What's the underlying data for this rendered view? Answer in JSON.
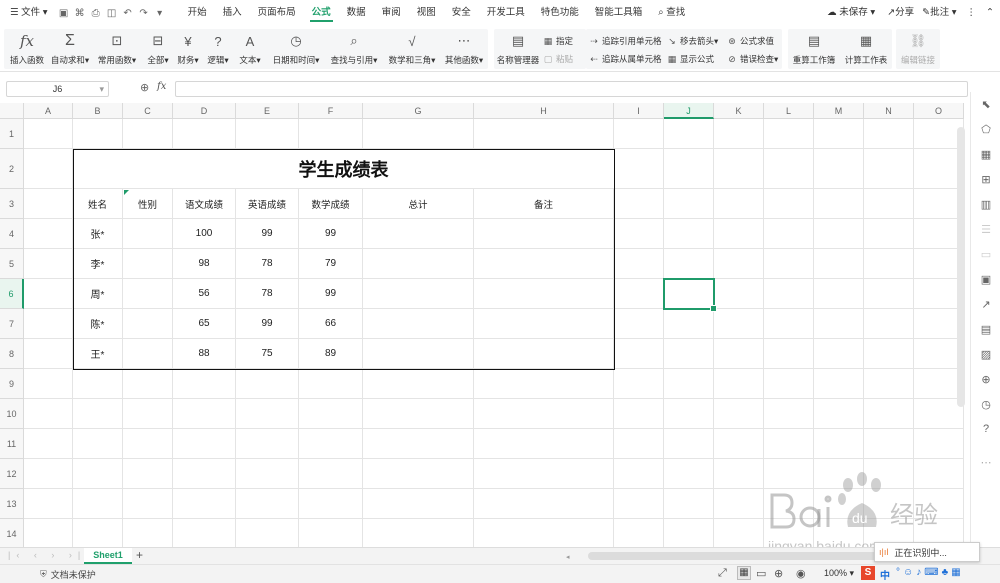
{
  "menu": {
    "file": "文件",
    "tabs": [
      "开始",
      "插入",
      "页面布局",
      "公式",
      "数据",
      "审阅",
      "视图",
      "安全",
      "开发工具",
      "特色功能",
      "智能工具箱"
    ],
    "active_tab": "公式",
    "search": "查找",
    "unsaved": "未保存",
    "share": "分享",
    "comment": "批注"
  },
  "ribbon": {
    "insert_function": "插入函数",
    "autosum": "自动求和",
    "common_functions": "常用函数",
    "all": "全部",
    "finance": "财务",
    "logic": "逻辑",
    "text": "文本",
    "datetime": "日期和时间",
    "lookup": "查找与引用",
    "math": "数学和三角",
    "other": "其他函数",
    "name_manager": "名称管理器",
    "specify": "指定",
    "paste": "粘贴",
    "trace_precedents": "追踪引用单元格",
    "trace_dependents": "追踪从属单元格",
    "remove_arrows": "移去箭头",
    "show_formulas": "显示公式",
    "formula_eval": "公式求值",
    "error_check": "错误检查",
    "recalc_workbook": "重算工作簿",
    "calc_sheet": "计算工作表",
    "edit_links": "编辑链接"
  },
  "formula_bar": {
    "name_box": "J6",
    "fx": "fx",
    "value": ""
  },
  "columns": [
    "A",
    "B",
    "C",
    "D",
    "E",
    "F",
    "G",
    "H",
    "I",
    "J",
    "K",
    "L",
    "M",
    "N",
    "O"
  ],
  "rows": [
    "1",
    "2",
    "3",
    "4",
    "5",
    "6",
    "7",
    "8",
    "9",
    "10",
    "11",
    "12",
    "13",
    "14"
  ],
  "selected_cell": "J6",
  "sheet": {
    "title": "学生成绩表",
    "headers": [
      "姓名",
      "性别",
      "语文成绩",
      "英语成绩",
      "数学成绩",
      "总计",
      "备注"
    ],
    "records": [
      [
        "张*",
        "",
        "100",
        "99",
        "99",
        "",
        ""
      ],
      [
        "李*",
        "",
        "98",
        "78",
        "79",
        "",
        ""
      ],
      [
        "周*",
        "",
        "56",
        "78",
        "99",
        "",
        ""
      ],
      [
        "陈*",
        "",
        "65",
        "99",
        "66",
        "",
        ""
      ],
      [
        "王*",
        "",
        "88",
        "75",
        "89",
        "",
        ""
      ]
    ]
  },
  "tabs": {
    "sheet1": "Sheet1",
    "add": "+"
  },
  "status": {
    "protection": "文档未保护",
    "zoom": "100%",
    "ime": "中",
    "popup": "正在识别中..."
  },
  "watermark": {
    "brand": "Bai du 经验",
    "url": "jingyan.baidu.com"
  },
  "accent_color": "#20a06c"
}
